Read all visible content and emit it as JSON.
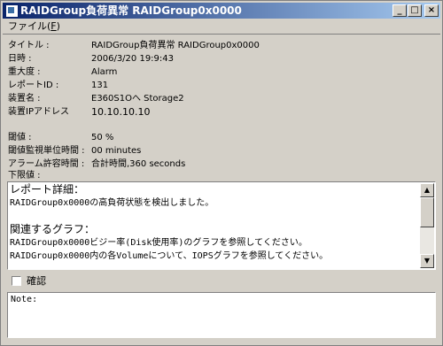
{
  "window": {
    "title": "RAIDGroup負荷異常   RAIDGroup0x0000",
    "controls": {
      "minimize": "_",
      "maximize": "□",
      "close": "×"
    }
  },
  "menu": {
    "file_label_pre": "ファイル(",
    "file_mnemonic": "F",
    "file_label_post": ")"
  },
  "fields": [
    {
      "label": "タイトル :",
      "value": "RAIDGroup負荷異常  RAIDGroup0x0000"
    },
    {
      "label": "日時 :",
      "value": "2006/3/20  19:9:43"
    },
    {
      "label": "重大度 :",
      "value": "Alarm"
    },
    {
      "label": "レポートID :",
      "value": "131"
    },
    {
      "label": "装置名 :",
      "value": "E360S1Oへ  Storage2"
    },
    {
      "label": "装置IPアドレス",
      "value": "10.10.10.10"
    }
  ],
  "thresholds": [
    {
      "label": "閾値 :",
      "value": "50 %"
    },
    {
      "label": "閾値監視単位時間 :",
      "value": "00 minutes"
    },
    {
      "label": "アラーム許容時間 :",
      "value": "合計時間,360 seconds"
    },
    {
      "label": "下限値 :",
      "value": ""
    }
  ],
  "detail": {
    "lines": [
      "レポート詳細：",
      "RAIDGroup0x0000の高負荷状態を検出しました。",
      "",
      "関連するグラフ：",
      "RAIDGroup0x0000ビジー率(Disk使用率)のグラフを参照してください。",
      "RAIDGroup0x0000内の各Volumeについて、IOPSグラフを参照してください。"
    ],
    "scroll_up": "▲",
    "scroll_down": "▼"
  },
  "confirm": {
    "label": "確認",
    "checked": false
  },
  "note": {
    "text": "Note:"
  }
}
